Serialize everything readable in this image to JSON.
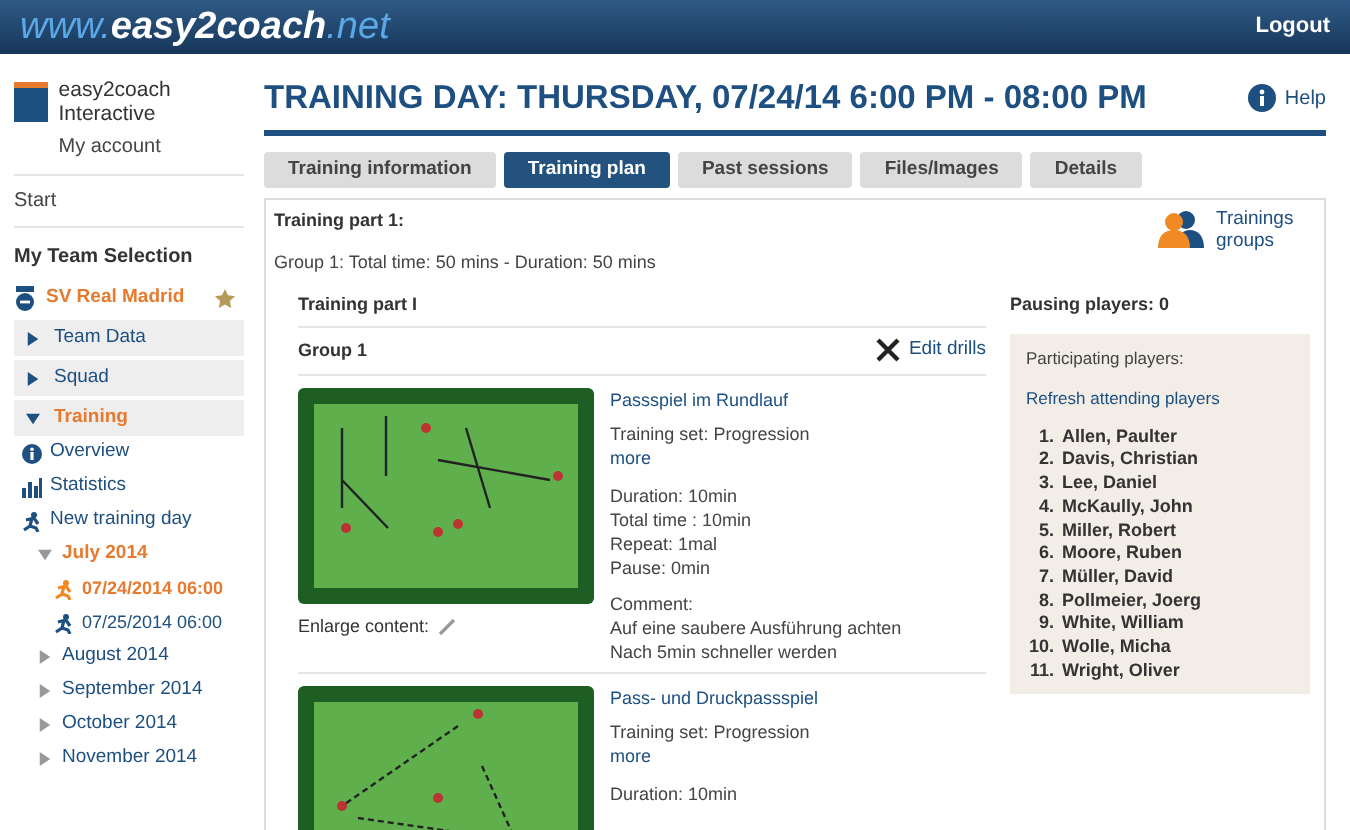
{
  "header": {
    "logo_prefix": "www.",
    "logo_main": "easy2coach",
    "logo_suffix": ".net",
    "logout": "Logout"
  },
  "account": {
    "name": "easy2coach Interactive",
    "link": "My account"
  },
  "sidebar": {
    "start": "Start",
    "section_title": "My Team Selection",
    "team": "SV Real Madrid",
    "items": [
      {
        "kind": "section",
        "label": "Team Data",
        "expanded": false,
        "selected": false
      },
      {
        "kind": "section",
        "label": "Squad",
        "expanded": false,
        "selected": false
      },
      {
        "kind": "section",
        "label": "Training",
        "expanded": true,
        "selected": true
      },
      {
        "kind": "info",
        "label": "Overview",
        "selected": false
      },
      {
        "kind": "stats",
        "label": "Statistics",
        "selected": false
      },
      {
        "kind": "runner",
        "label": "New training day",
        "selected": false
      },
      {
        "kind": "month",
        "label": "July 2014",
        "expanded": true,
        "selected": true
      },
      {
        "kind": "date",
        "label": "07/24/2014 06:00",
        "selected": true
      },
      {
        "kind": "date",
        "label": "07/25/2014 06:00",
        "selected": false
      },
      {
        "kind": "month",
        "label": "August 2014",
        "expanded": false,
        "selected": false
      },
      {
        "kind": "month",
        "label": "September 2014",
        "expanded": false,
        "selected": false
      },
      {
        "kind": "month",
        "label": "October 2014",
        "expanded": false,
        "selected": false
      },
      {
        "kind": "month",
        "label": "November 2014",
        "expanded": false,
        "selected": false
      }
    ]
  },
  "title": "TRAINING DAY: THURSDAY, 07/24/14 6:00 PM - 08:00 PM",
  "help": "Help",
  "tabs": [
    {
      "label": "Training information",
      "selected": false
    },
    {
      "label": "Training plan",
      "selected": true
    },
    {
      "label": "Past sessions",
      "selected": false
    },
    {
      "label": "Files/Images",
      "selected": false
    },
    {
      "label": "Details",
      "selected": false
    }
  ],
  "part": {
    "heading": "Training part 1:",
    "summary": "Group 1: Total time: 50 mins - Duration: 50 mins",
    "groups_link": "Trainings groups",
    "subheading": "Training part I",
    "group": "Group 1",
    "edit": "Edit drills"
  },
  "drills": [
    {
      "title": "Passspiel im Rundlauf",
      "set": "Training set: Progression",
      "more": "more",
      "details": [
        "Duration: 10min",
        "Total time : 10min",
        "Repeat: 1mal",
        "Pause: 0min"
      ],
      "enlarge": "Enlarge content:",
      "comment_label": "Comment:",
      "comments": [
        "Auf eine saubere Ausführung achten",
        "Nach 5min schneller werden"
      ]
    },
    {
      "title": "Pass- und Druckpassspiel",
      "set": "Training set: Progression",
      "more": "more",
      "details": [
        "Duration: 10min"
      ]
    }
  ],
  "players": {
    "pausing": "Pausing players: 0",
    "participating": "Participating players:",
    "refresh": "Refresh attending players",
    "list": [
      {
        "number": "1.",
        "name": "Allen, Paulter"
      },
      {
        "number": "2.",
        "name": "Davis, Christian"
      },
      {
        "number": "3.",
        "name": "Lee, Daniel"
      },
      {
        "number": "4.",
        "name": "McKaully, John"
      },
      {
        "number": "5.",
        "name": "Miller, Robert"
      },
      {
        "number": "6.",
        "name": "Moore, Ruben"
      },
      {
        "number": "7.",
        "name": "Müller, David"
      },
      {
        "number": "8.",
        "name": "Pollmeier, Joerg"
      },
      {
        "number": "9.",
        "name": "White, William"
      },
      {
        "number": "10.",
        "name": "Wolle, Micha"
      },
      {
        "number": "11.",
        "name": "Wright, Oliver"
      }
    ]
  }
}
